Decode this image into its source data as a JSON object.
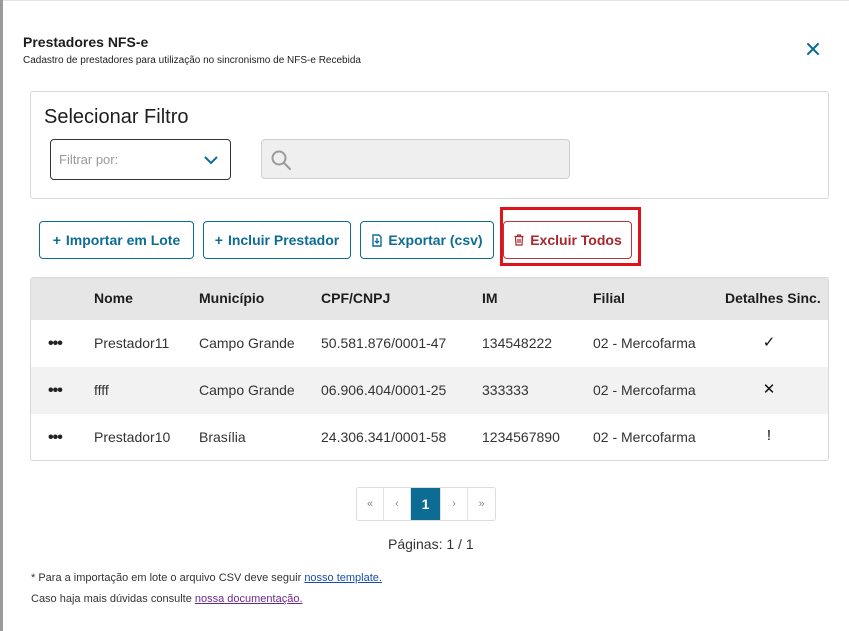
{
  "modal": {
    "title": "Prestadores NFS-e",
    "subtitle": "Cadastro de prestadores para utilização no sincronismo de NFS-e Recebida",
    "close_icon": "close-icon"
  },
  "filter": {
    "title": "Selecionar Filtro",
    "select_placeholder": "Filtrar por:",
    "search_value": "",
    "search_icon": "search-icon"
  },
  "actions": {
    "import_label": "Importar em Lote",
    "include_label": "Incluir Prestador",
    "export_label": "Exportar (csv)",
    "delete_all_label": "Excluir Todos"
  },
  "table": {
    "headers": [
      "Nome",
      "Município",
      "CPF/CNPJ",
      "IM",
      "Filial",
      "Detalhes Sinc."
    ],
    "rows": [
      {
        "actions": "•••",
        "nome": "Prestador11",
        "municipio": "Campo Grande",
        "cpf_cnpj": "50.581.876/0001-47",
        "im": "134548222",
        "filial": "02 - Mercofarma",
        "detalhes": "✓",
        "status_icon": "check-icon"
      },
      {
        "actions": "•••",
        "nome": "ffff",
        "municipio": "Campo Grande",
        "cpf_cnpj": "06.906.404/0001-25",
        "im": "333333",
        "filial": "02 - Mercofarma",
        "detalhes": "✕",
        "status_icon": "x-icon"
      },
      {
        "actions": "•••",
        "nome": "Prestador10",
        "municipio": "Brasília",
        "cpf_cnpj": "24.306.341/0001-58",
        "im": "1234567890",
        "filial": "02 - Mercofarma",
        "detalhes": "!",
        "status_icon": "exclamation-icon"
      }
    ]
  },
  "pagination": {
    "first": "«",
    "prev": "‹",
    "current": "1",
    "next": "›",
    "last": "»",
    "info": "Páginas: 1 / 1"
  },
  "notes": {
    "line1_text": "* Para a importação em lote o arquivo CSV deve seguir ",
    "line1_link": "nosso template.",
    "line2_text": "Caso haja mais dúvidas consulte ",
    "line2_link": "nossa documentação."
  },
  "colors": {
    "primary": "#0c6c94",
    "danger": "#a9262d",
    "highlight": "#e0121a"
  }
}
